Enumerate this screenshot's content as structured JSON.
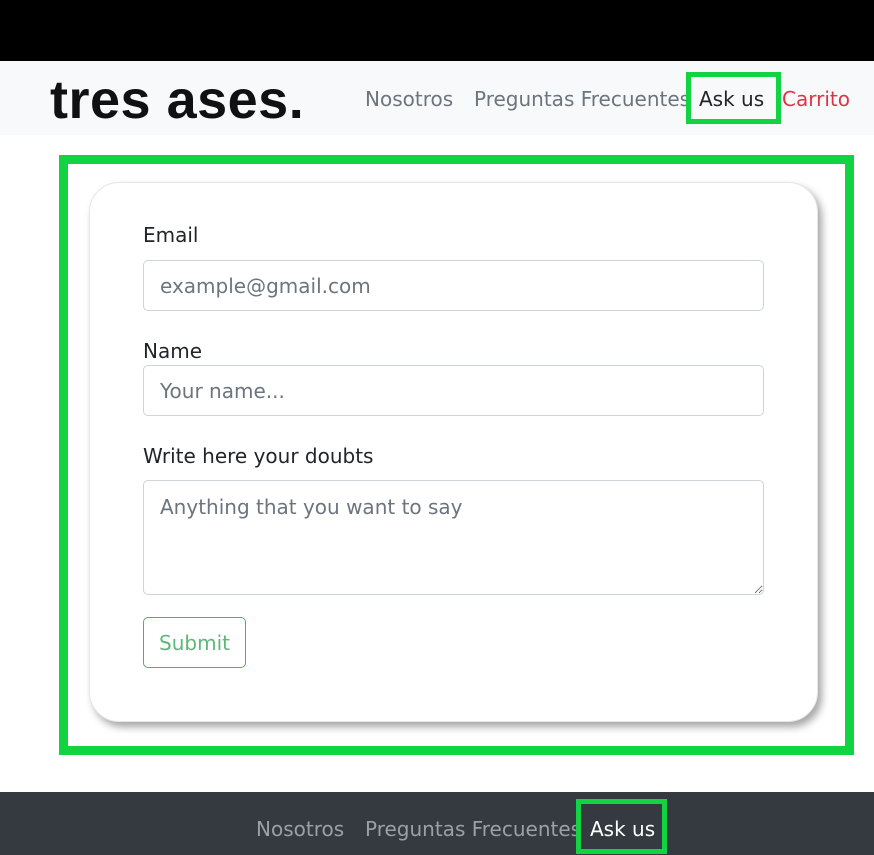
{
  "brand": "tres ases.",
  "header_nav": {
    "nosotros": "Nosotros",
    "faq": "Preguntas Frecuentes",
    "ask": "Ask us",
    "cart": "Carrito"
  },
  "form": {
    "email_label": "Email",
    "email_placeholder": "example@gmail.com",
    "name_label": "Name",
    "name_placeholder": "Your name...",
    "doubts_label": "Write here your doubts",
    "doubts_placeholder": "Anything that you want to say",
    "submit_label": "Submit"
  },
  "footer_nav": {
    "nosotros": "Nosotros",
    "faq": "Preguntas Frecuentes",
    "ask": "Ask us"
  },
  "colors": {
    "highlight": "#12d442",
    "cart": "#dc3545",
    "submit": "#5cb878",
    "footer_bg": "#343a40"
  }
}
